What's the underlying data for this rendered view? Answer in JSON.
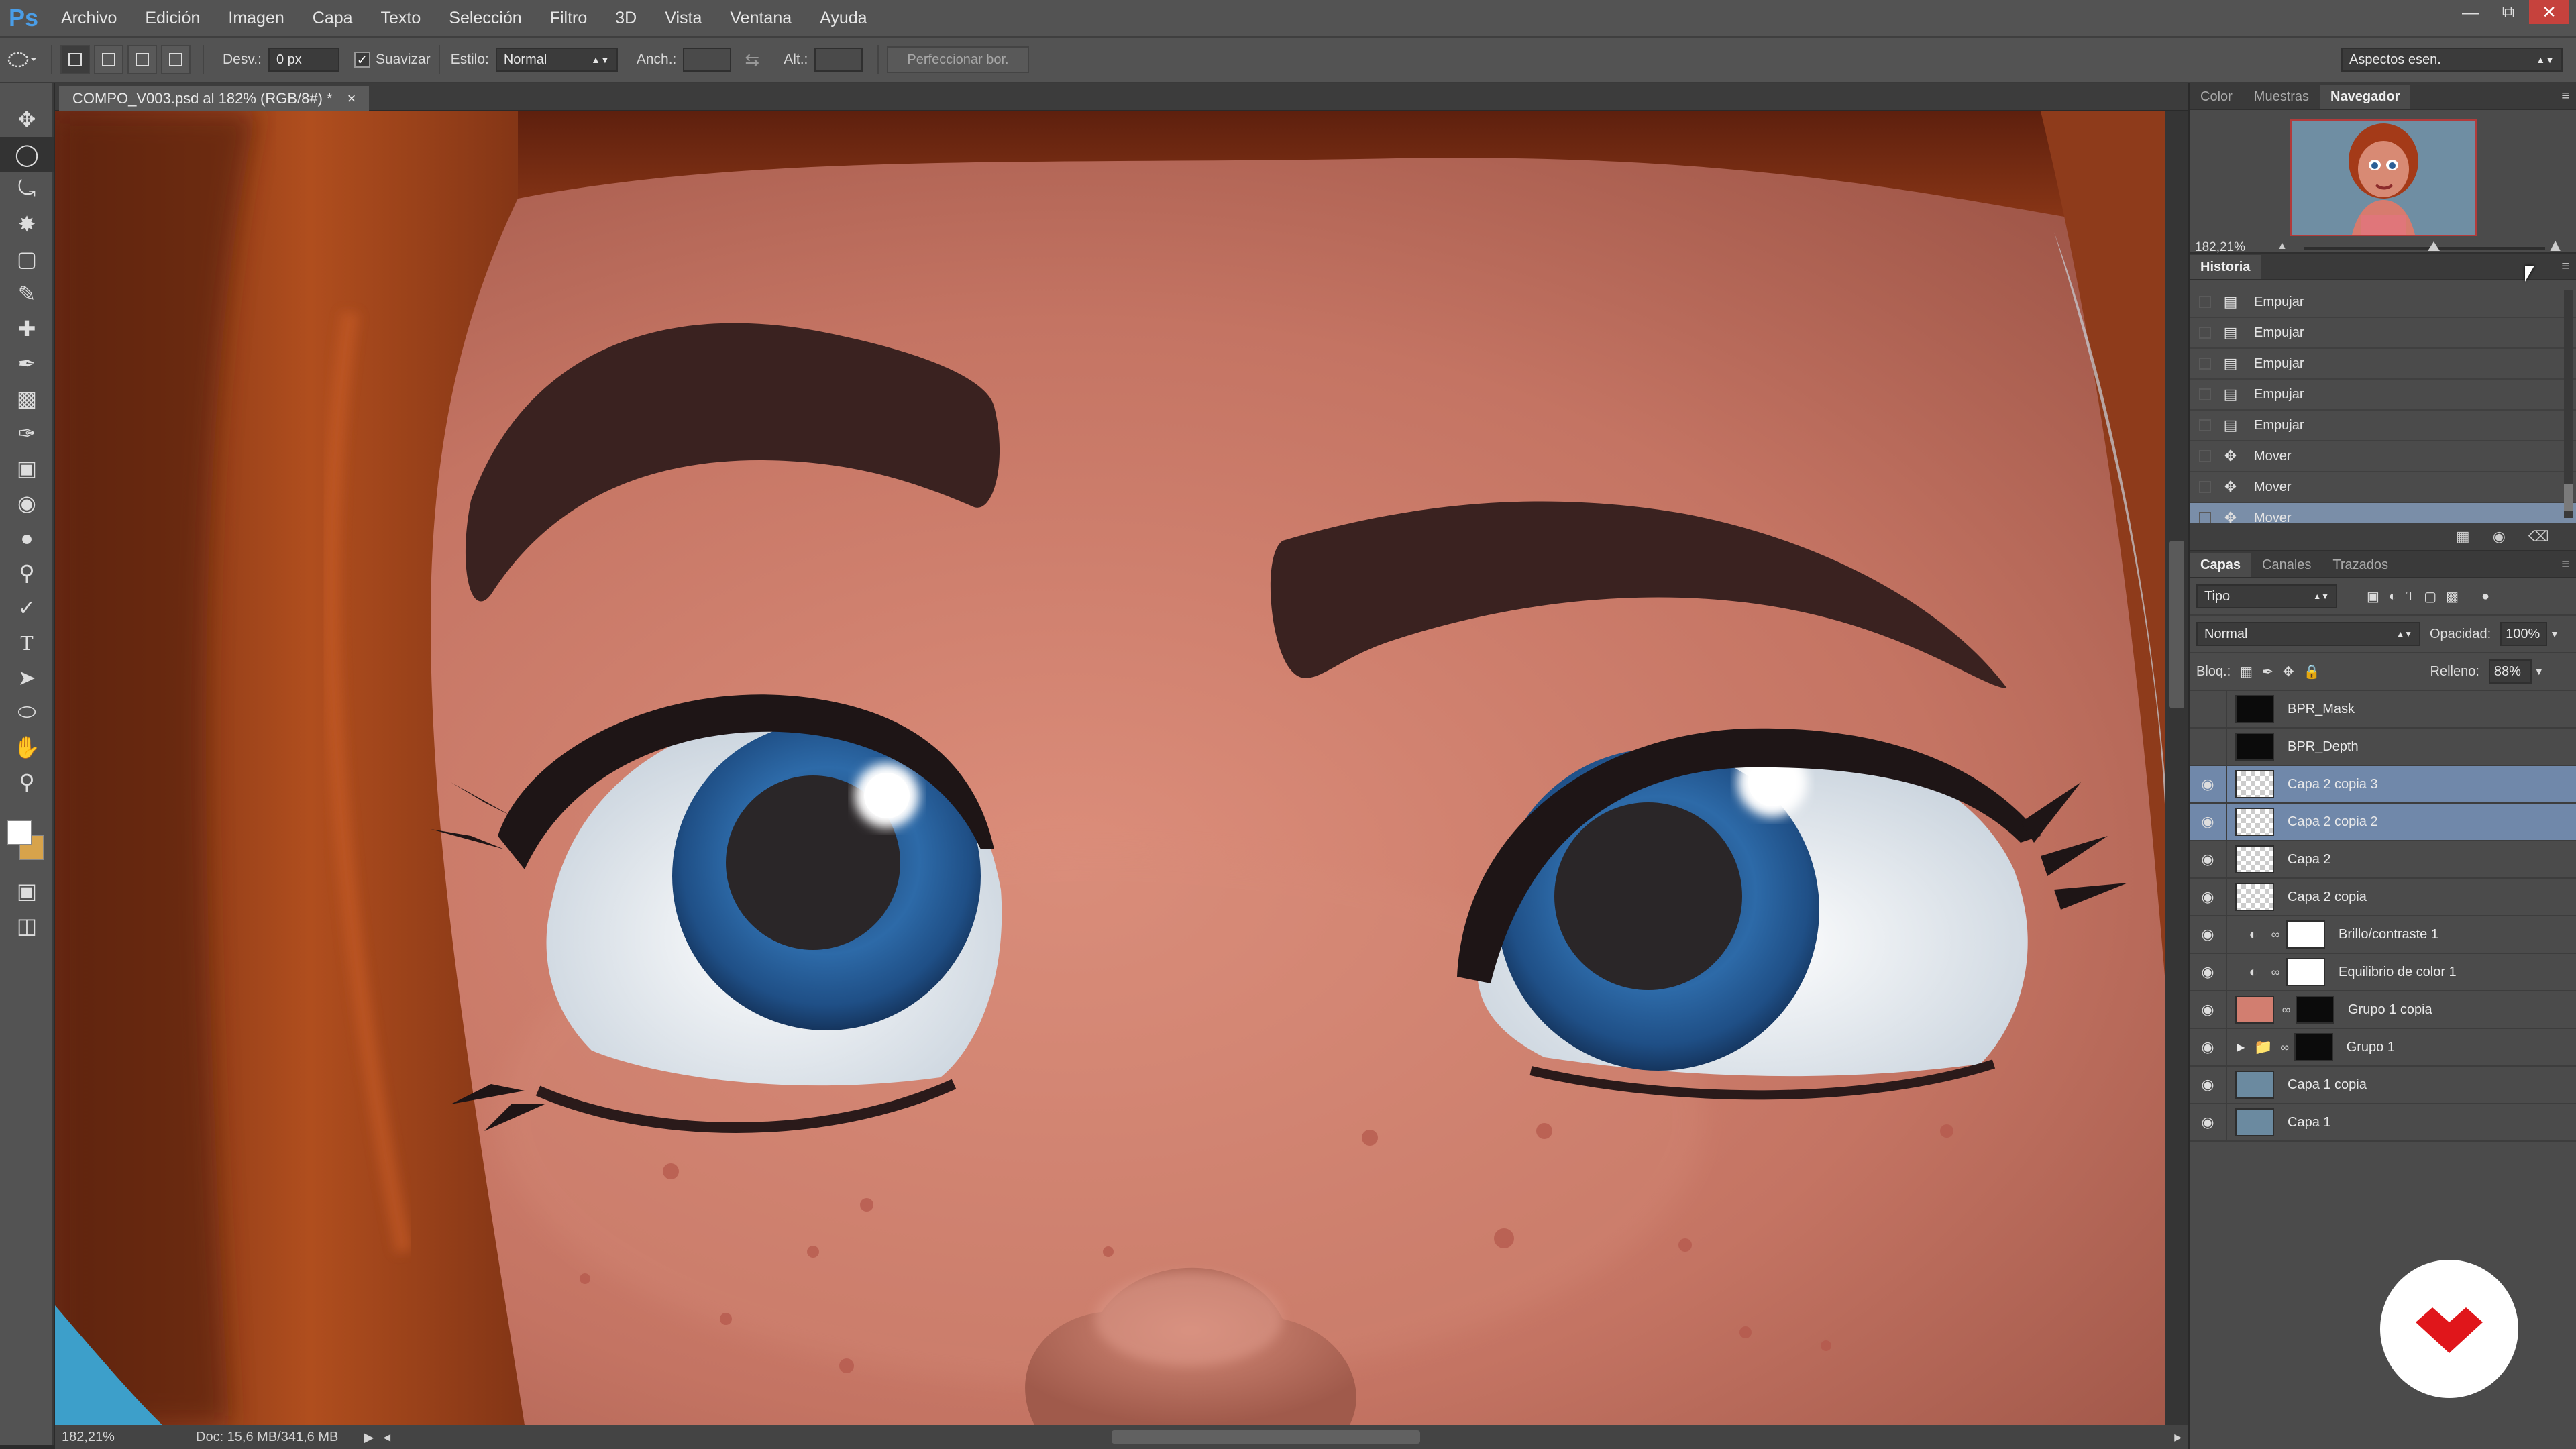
{
  "menubar": {
    "app_logo": "Ps",
    "items": [
      "Archivo",
      "Edición",
      "Imagen",
      "Capa",
      "Texto",
      "Selección",
      "Filtro",
      "3D",
      "Vista",
      "Ventana",
      "Ayuda"
    ],
    "window_controls": [
      "minimize-icon",
      "restore-icon",
      "close-icon"
    ]
  },
  "options": {
    "feather_label": "Desv.:",
    "feather_value": "0 px",
    "antialias_label": "Suavizar",
    "antialias_checked": true,
    "style_label": "Estilo:",
    "style_value": "Normal",
    "width_label": "Anch.:",
    "height_label": "Alt.:",
    "refine_label": "Perfeccionar bor.",
    "workspace_value": "Aspectos esen."
  },
  "document": {
    "tab_title": "COMPO_V003.psd al 182% (RGB/8#) *",
    "close_glyph": "×"
  },
  "status": {
    "zoom": "182,21%",
    "doc": "Doc: 15,6 MB/341,6 MB"
  },
  "navigator": {
    "tabs": [
      "Color",
      "Muestras",
      "Navegador"
    ],
    "active_tab": "Navegador",
    "zoom": "182,21%"
  },
  "history": {
    "title": "Historia",
    "items": [
      {
        "label": "Empujar",
        "icon": "document-icon",
        "selected": false
      },
      {
        "label": "Empujar",
        "icon": "document-icon",
        "selected": false
      },
      {
        "label": "Empujar",
        "icon": "document-icon",
        "selected": false
      },
      {
        "label": "Empujar",
        "icon": "document-icon",
        "selected": false
      },
      {
        "label": "Empujar",
        "icon": "document-icon",
        "selected": false
      },
      {
        "label": "Mover",
        "icon": "move-icon",
        "selected": false
      },
      {
        "label": "Mover",
        "icon": "move-icon",
        "selected": false
      },
      {
        "label": "Mover",
        "icon": "move-icon",
        "selected": true
      }
    ]
  },
  "layers": {
    "tabs": [
      "Capas",
      "Canales",
      "Trazados"
    ],
    "active_tab": "Capas",
    "filter_value": "Tipo",
    "blend_mode": "Normal",
    "opacity_label": "Opacidad:",
    "opacity_value": "100%",
    "lock_label": "Bloq.:",
    "fill_label": "Relleno:",
    "fill_value": "88%",
    "items": [
      {
        "name": "BPR_Mask",
        "visible": false,
        "thumb": "black",
        "selected": false,
        "kind": "layer"
      },
      {
        "name": "BPR_Depth",
        "visible": false,
        "thumb": "black",
        "selected": false,
        "kind": "layer"
      },
      {
        "name": "Capa 2 copia 3",
        "visible": true,
        "thumb": "checker",
        "selected": true,
        "kind": "layer"
      },
      {
        "name": "Capa 2 copia 2",
        "visible": true,
        "thumb": "checker",
        "selected": true,
        "kind": "layer"
      },
      {
        "name": "Capa 2",
        "visible": true,
        "thumb": "checker",
        "selected": false,
        "kind": "layer"
      },
      {
        "name": "Capa 2 copia",
        "visible": true,
        "thumb": "checker",
        "selected": false,
        "kind": "layer"
      },
      {
        "name": "Brillo/contraste 1",
        "visible": true,
        "thumb": "white",
        "selected": false,
        "kind": "adjustment"
      },
      {
        "name": "Equilibrio de color 1",
        "visible": true,
        "thumb": "white",
        "selected": false,
        "kind": "adjustment"
      },
      {
        "name": "Grupo 1 copia",
        "visible": true,
        "thumb": "portrait",
        "selected": false,
        "kind": "masked"
      },
      {
        "name": "Grupo 1",
        "visible": true,
        "thumb": "black",
        "selected": false,
        "kind": "group"
      },
      {
        "name": "Capa 1 copia",
        "visible": true,
        "thumb": "blue",
        "selected": false,
        "kind": "layer"
      },
      {
        "name": "Capa 1",
        "visible": true,
        "thumb": "blue",
        "selected": false,
        "kind": "layer"
      }
    ]
  },
  "colors": {
    "foreground": "#ffffff",
    "background": "#d7a34b",
    "selection": "#7088aa",
    "accent": "#4a9ee8",
    "badge": "#e0161b"
  }
}
